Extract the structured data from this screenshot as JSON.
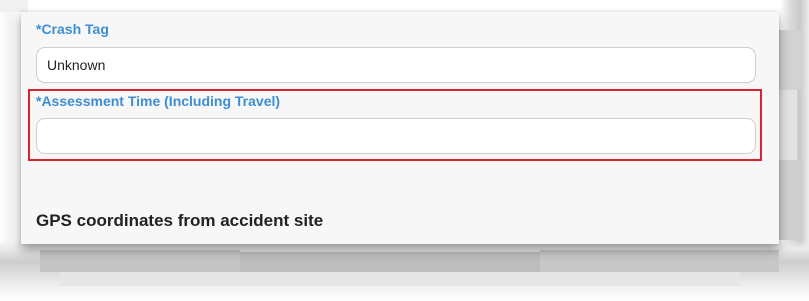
{
  "form": {
    "crash_tag": {
      "label": "*Crash Tag",
      "value": "Unknown"
    },
    "assessment_time": {
      "label": "*Assessment Time (Including Travel)",
      "value": "",
      "highlighted": true,
      "highlight_color": "#d9232e"
    },
    "gps_section": {
      "heading": "GPS coordinates from accident site"
    }
  },
  "colors": {
    "label_blue": "#3d8ed4",
    "panel_background": "#f7f7f7"
  }
}
